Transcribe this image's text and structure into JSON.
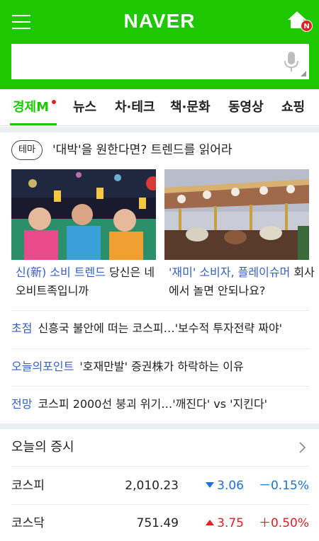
{
  "header": {
    "logo": "NAVER",
    "notification_badge": "N",
    "search_value": "",
    "brand_color": "#1ec800"
  },
  "tabs": [
    {
      "label": "경제M",
      "active": true,
      "new_dot": true
    },
    {
      "label": "뉴스"
    },
    {
      "label": "차·테크"
    },
    {
      "label": "책·문화"
    },
    {
      "label": "동영상"
    },
    {
      "label": "쇼핑"
    }
  ],
  "theme": {
    "badge": "테마",
    "title": "'대박'을 원한다면? 트렌드를 읽어라",
    "articles": [
      {
        "highlight": "신(新) 소비 트렌드",
        "rest": " 당신은 네오비트족입니까"
      },
      {
        "highlight": "'재미' 소비자, 플레이슈머",
        "rest": " 회사에서 놀면 안되나요?"
      }
    ]
  },
  "news": [
    {
      "tag": "초점",
      "text": "신흥국 불안에 떠는 코스피…'보수적 투자전략 짜야'"
    },
    {
      "tag": "오늘의포인트",
      "text": "'호재만발' 증권株가 하락하는 이유"
    },
    {
      "tag": "전망",
      "text": "코스피 2000선 붕괴 위기…'깨진다' vs '지킨다'"
    }
  ],
  "stocks": {
    "title": "오늘의 증시",
    "rows": [
      {
        "name": "코스피",
        "value": "2,010.23",
        "change": "3.06",
        "pct": "－0.15%",
        "direction": "down"
      },
      {
        "name": "코스닥",
        "value": "751.49",
        "change": "3.75",
        "pct": "＋0.50%",
        "direction": "up"
      }
    ]
  }
}
